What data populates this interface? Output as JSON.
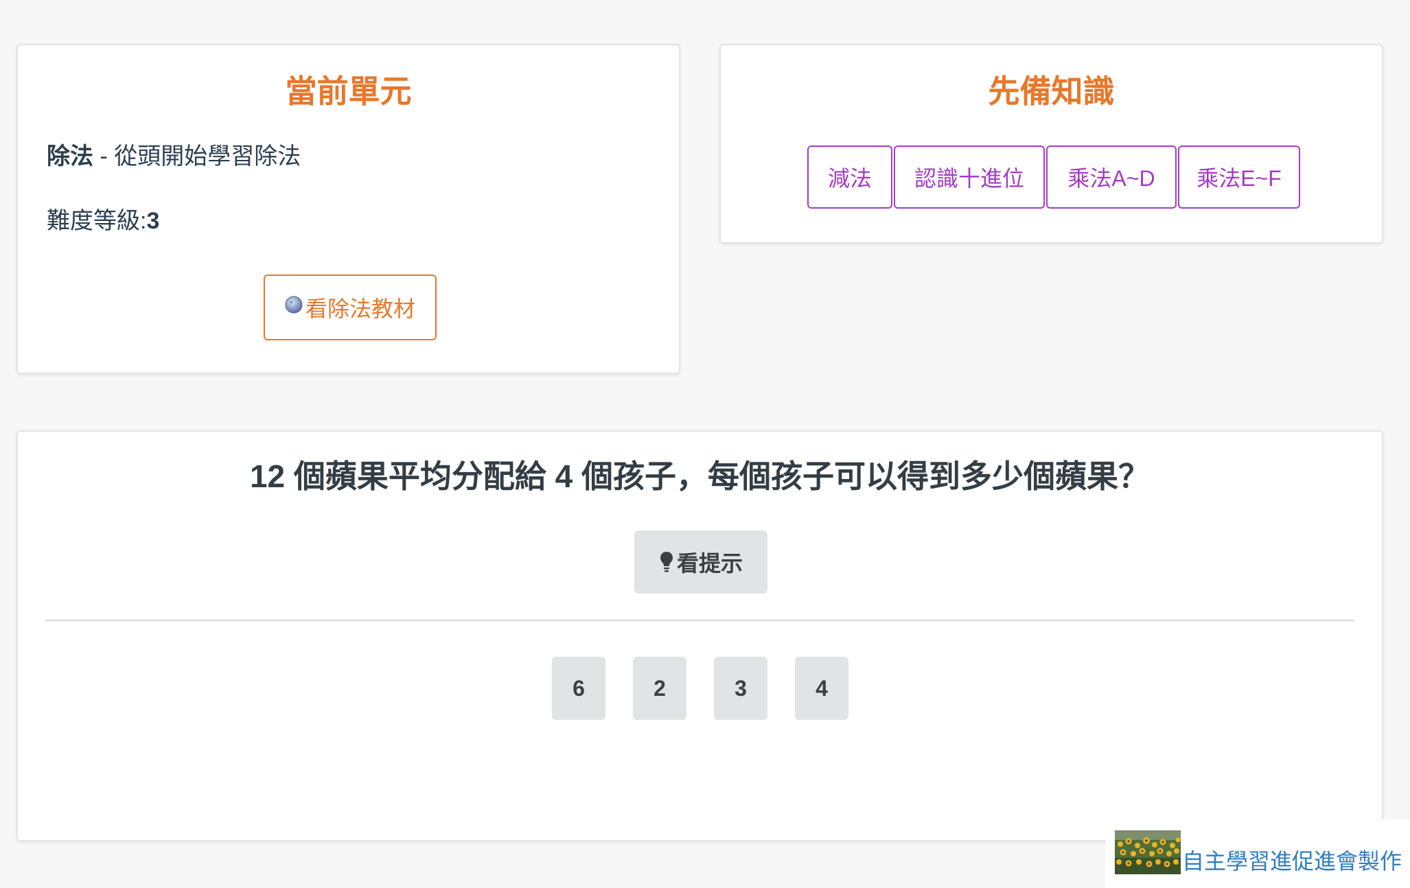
{
  "current_unit": {
    "title": "當前單元",
    "unit_name": "除法",
    "separator": " - ",
    "unit_description": "從頭開始學習除法",
    "level_label": "難度等級:",
    "level_value": "3",
    "material_button_label": "看除法教材",
    "material_icon": "globe-icon"
  },
  "prerequisites": {
    "title": "先備知識",
    "items": [
      {
        "label": "減法"
      },
      {
        "label": "認識十進位"
      },
      {
        "label": "乘法A~D"
      },
      {
        "label": "乘法E~F"
      }
    ]
  },
  "question": {
    "text": "12 個蘋果平均分配給 4 個孩子，每個孩子可以得到多少個蘋果？",
    "hint_button_label": "看提示",
    "hint_icon": "lightbulb-icon",
    "answers": [
      "6",
      "2",
      "3",
      "4"
    ]
  },
  "footer": {
    "credit_text": "自主學習進促進會製作",
    "thumbnail_icon": "sunflower-field-image"
  },
  "colors": {
    "background": "#f7f7f7",
    "accent_orange": "#e8782a",
    "accent_purple": "#a53bc6",
    "button_gray": "#e2e3e5",
    "link_blue": "#2f7ec2"
  }
}
